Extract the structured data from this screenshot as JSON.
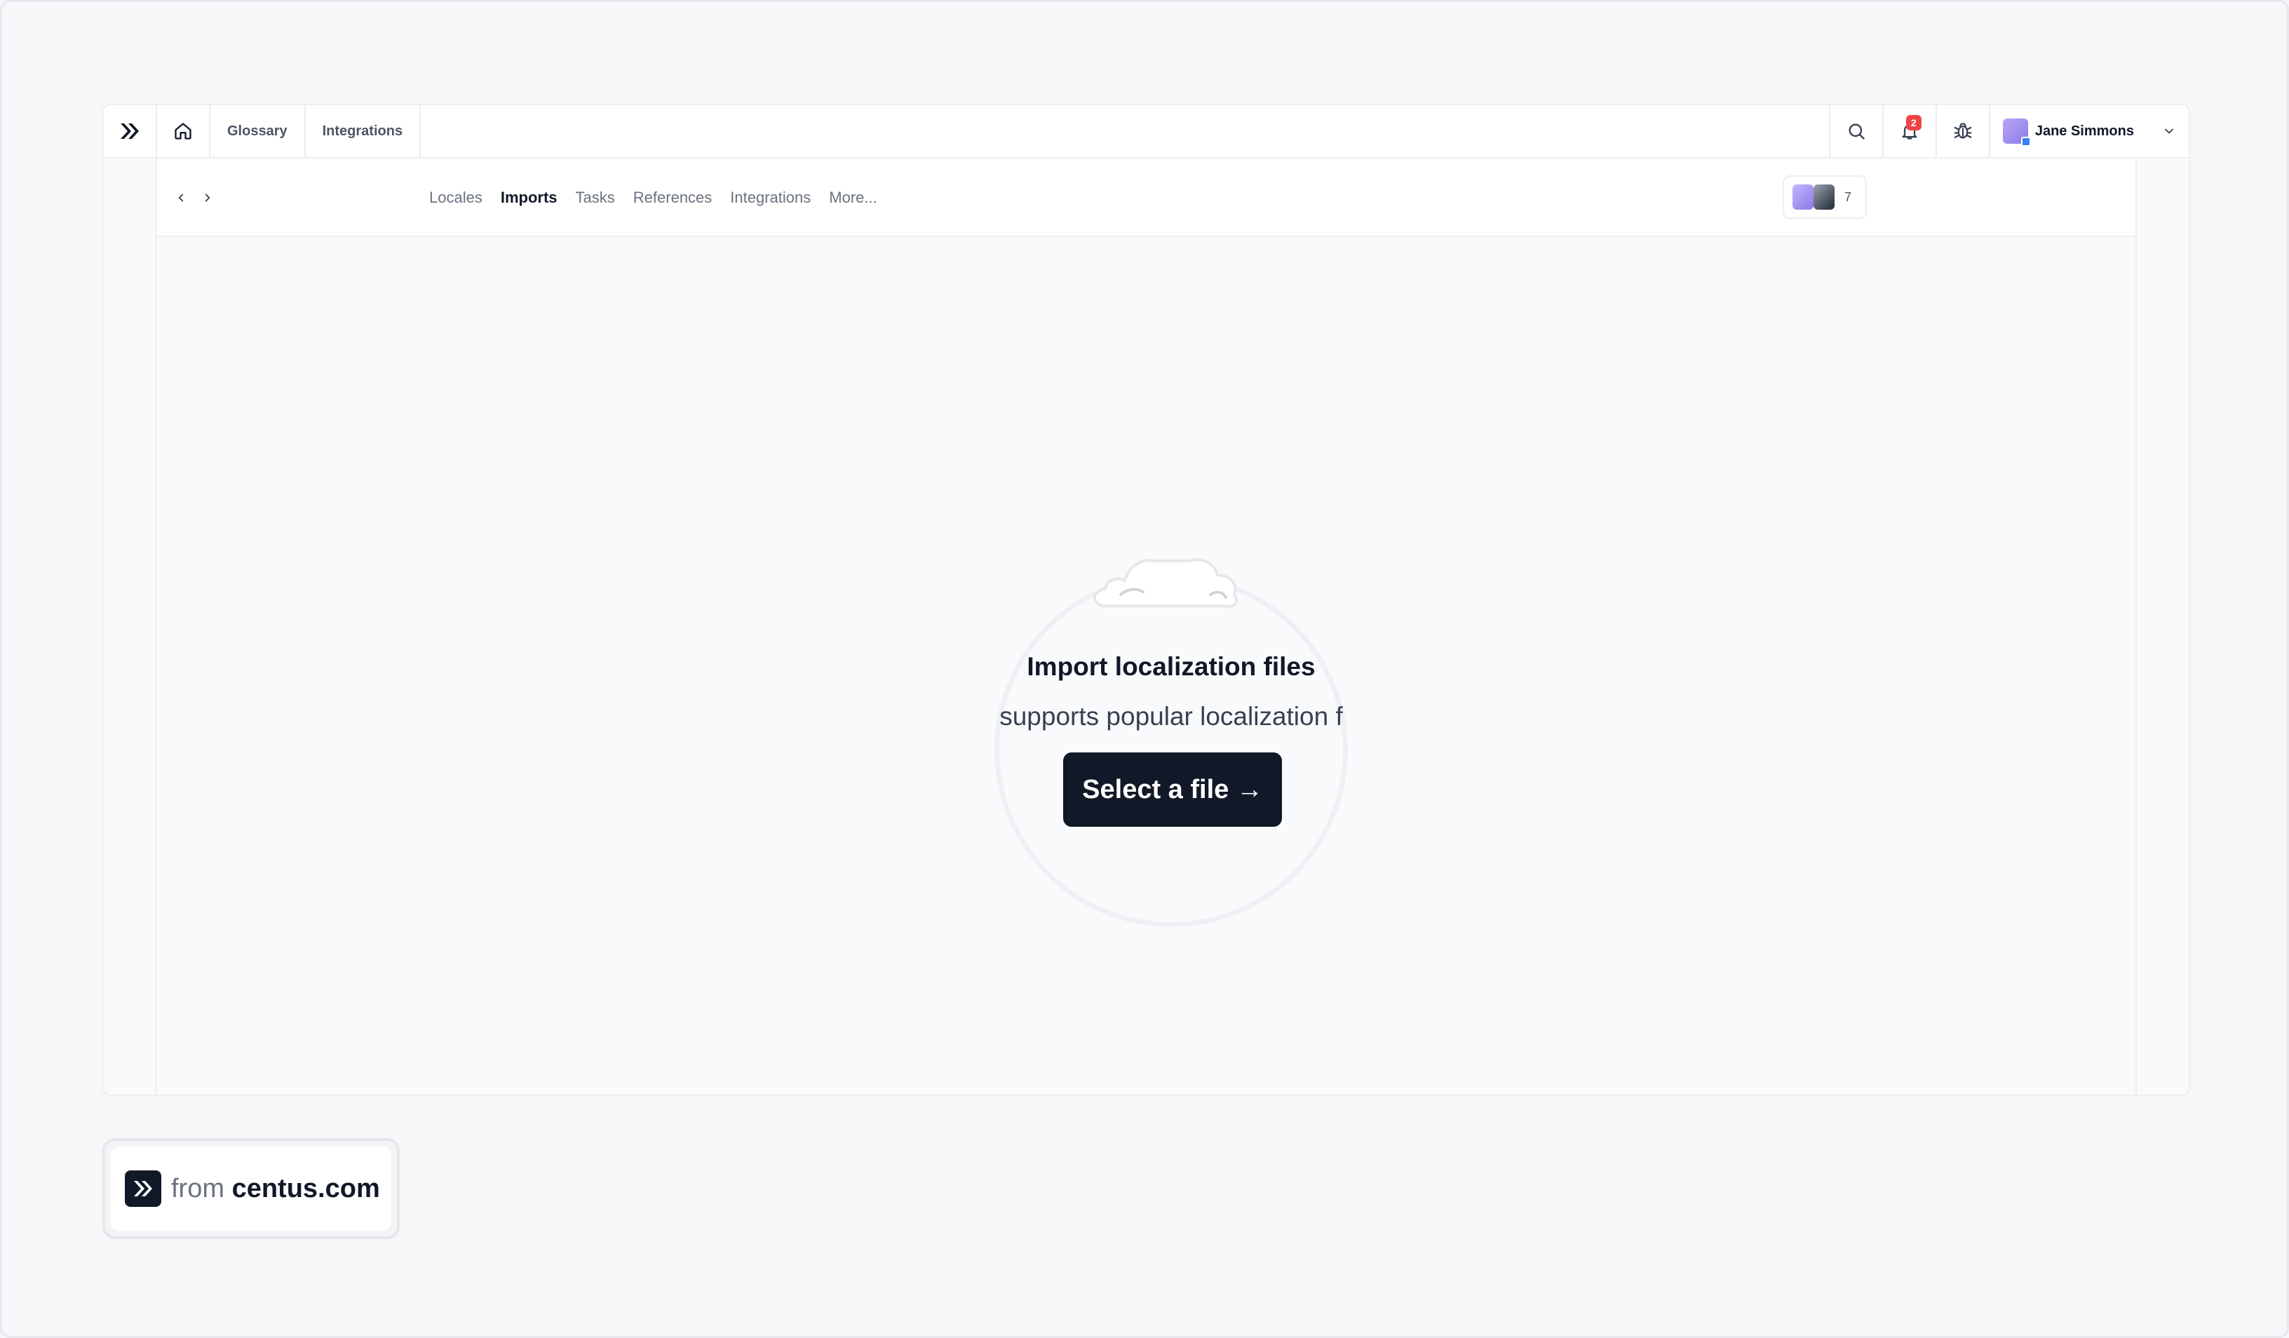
{
  "topnav": {
    "logo_icon": "centus-logo-icon",
    "home_icon": "home-icon",
    "links": [
      "Glossary",
      "Integrations"
    ],
    "search_icon": "search-icon",
    "notifications_icon": "bell-icon",
    "notifications_count": "2",
    "bug_icon": "bug-icon",
    "user": {
      "name": "Jane Simmons",
      "avatar_icon": "avatar",
      "chevron_icon": "chevron-down-icon"
    }
  },
  "subbar": {
    "back_icon": "chevron-left-icon",
    "forward_icon": "chevron-right-icon",
    "tabs": [
      {
        "label": "Locales",
        "active": false
      },
      {
        "label": "Imports",
        "active": true
      },
      {
        "label": "Tasks",
        "active": false
      },
      {
        "label": "References",
        "active": false
      },
      {
        "label": "Integrations",
        "active": false
      },
      {
        "label": "More...",
        "active": false
      }
    ],
    "collaborators_count": "7"
  },
  "empty_state": {
    "icon": "cloud-upload-icon",
    "title": "Import localization files",
    "subtitle": "supports popular localization f",
    "button_label": "Select a file →"
  },
  "footer": {
    "from": "from",
    "site": "centus.com"
  },
  "colors": {
    "primary": "#111827",
    "badge_red": "#ef4444",
    "background": "#f6f7f9"
  }
}
